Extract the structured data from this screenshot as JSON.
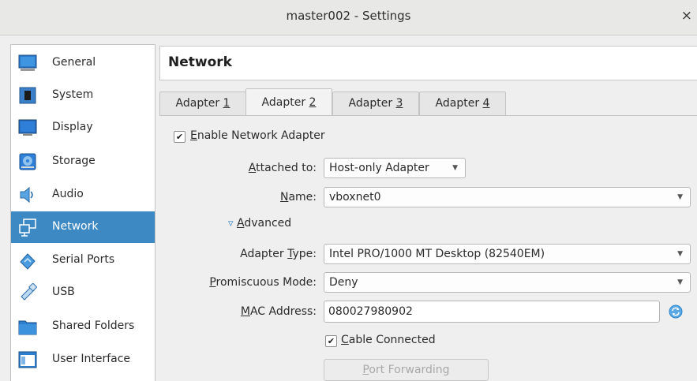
{
  "window": {
    "title": "master002 - Settings",
    "close_glyph": "×"
  },
  "sidebar": {
    "items": [
      {
        "label": "General",
        "icon": "monitor-icon"
      },
      {
        "label": "System",
        "icon": "chip-icon"
      },
      {
        "label": "Display",
        "icon": "display-icon"
      },
      {
        "label": "Storage",
        "icon": "disk-icon"
      },
      {
        "label": "Audio",
        "icon": "speaker-icon"
      },
      {
        "label": "Network",
        "icon": "network-icon",
        "active": true
      },
      {
        "label": "Serial Ports",
        "icon": "serial-icon"
      },
      {
        "label": "USB",
        "icon": "usb-icon"
      },
      {
        "label": "Shared Folders",
        "icon": "folder-icon"
      },
      {
        "label": "User Interface",
        "icon": "ui-icon"
      }
    ]
  },
  "main": {
    "heading": "Network",
    "tabs": [
      {
        "prefix": "Adapter ",
        "mnemonic": "1"
      },
      {
        "prefix": "Adapter ",
        "mnemonic": "2",
        "active": true
      },
      {
        "prefix": "Adapter ",
        "mnemonic": "3"
      },
      {
        "prefix": "Adapter ",
        "mnemonic": "4"
      }
    ],
    "enable_adapter": {
      "mnemonic": "E",
      "rest": "nable Network Adapter",
      "checked": true
    },
    "attached_to": {
      "pre": "",
      "mnemonic": "A",
      "post": "ttached to:",
      "value": "Host-only Adapter"
    },
    "name": {
      "pre": "",
      "mnemonic": "N",
      "post": "ame:",
      "value": "vboxnet0"
    },
    "advanced": {
      "pre": "",
      "mnemonic": "A",
      "post": "dvanced",
      "glyph": "▿"
    },
    "adapter_type": {
      "pre": "Adapter ",
      "mnemonic": "T",
      "post": "ype:",
      "value": "Intel PRO/1000 MT Desktop (82540EM)"
    },
    "promiscuous": {
      "pre": "",
      "mnemonic": "P",
      "post": "romiscuous Mode:",
      "value": "Deny"
    },
    "mac": {
      "pre": "",
      "mnemonic": "M",
      "post": "AC Address:",
      "value": "080027980902"
    },
    "cable": {
      "pre": "",
      "mnemonic": "C",
      "post": "able Connected",
      "checked": true
    },
    "port_forwarding": {
      "pre": "",
      "mnemonic": "P",
      "post": "ort Forwarding",
      "enabled": false
    }
  },
  "colors": {
    "accent": "#3d89c4",
    "refresh": "#2f86c9"
  }
}
